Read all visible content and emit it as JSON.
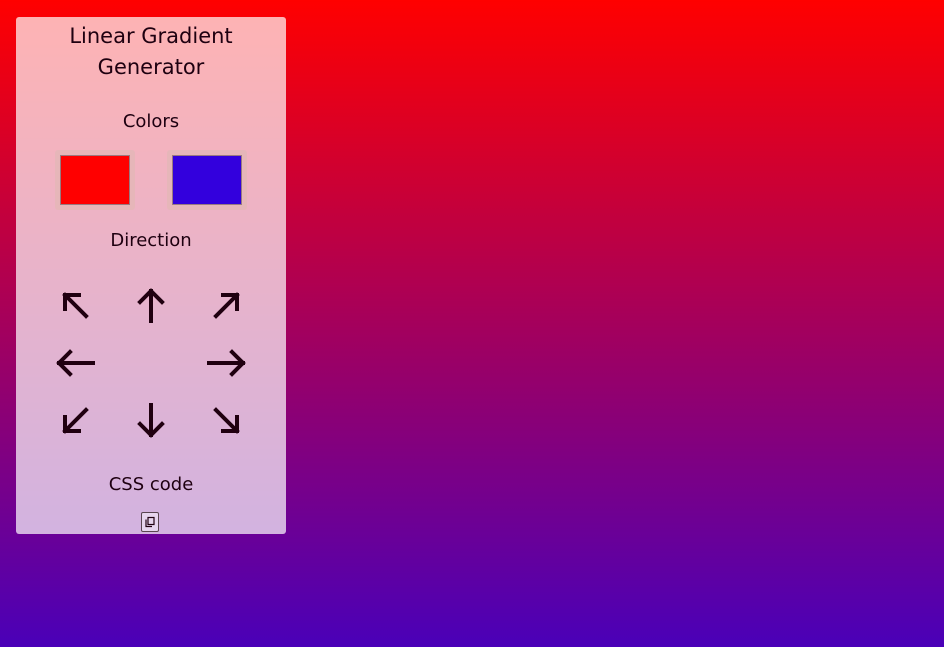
{
  "panel": {
    "title_line1": "Linear Gradient",
    "title_line2": "Generator",
    "colors_label": "Colors",
    "direction_label": "Direction",
    "css_label": "CSS code"
  },
  "colors": {
    "start": "#ff0000",
    "end": "#3300dd"
  },
  "background": {
    "direction": "to bottom",
    "top_color": "#ff0000",
    "bottom_color": "#4a00b8"
  },
  "directions": [
    {
      "name": "to-top-left",
      "icon": "arrow-up-left-icon"
    },
    {
      "name": "to-top",
      "icon": "arrow-up-icon"
    },
    {
      "name": "to-top-right",
      "icon": "arrow-up-right-icon"
    },
    {
      "name": "to-left",
      "icon": "arrow-left-icon"
    },
    {
      "name": "to-right",
      "icon": "arrow-right-icon"
    },
    {
      "name": "to-bottom-left",
      "icon": "arrow-down-left-icon"
    },
    {
      "name": "to-bottom",
      "icon": "arrow-down-icon"
    },
    {
      "name": "to-bottom-right",
      "icon": "arrow-down-right-icon"
    }
  ],
  "copy_button": {
    "icon": "copy-icon"
  }
}
